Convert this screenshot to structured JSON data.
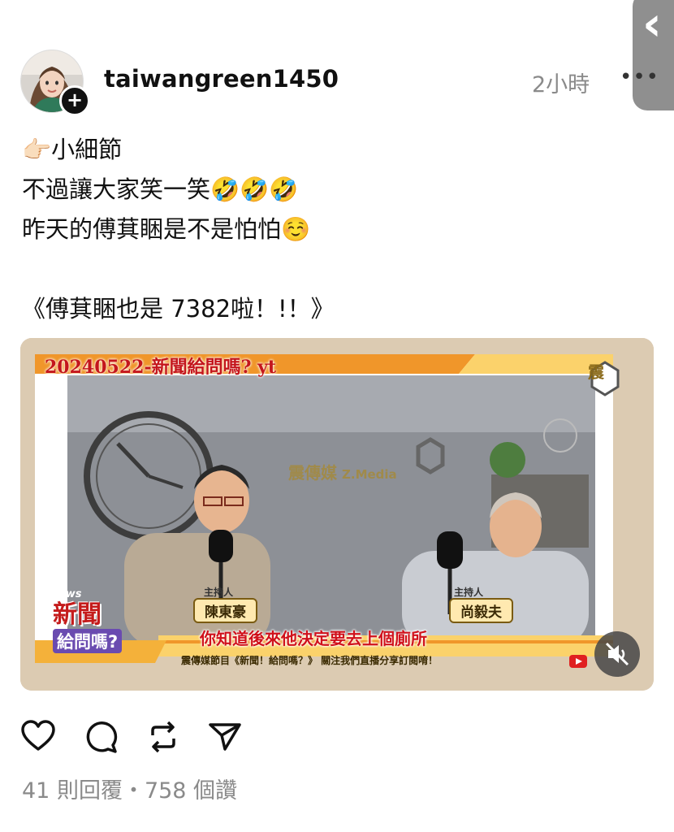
{
  "post": {
    "username": "taiwangreen1450",
    "timestamp": "2小時",
    "more_label": "•••",
    "follow_label": "+",
    "text_lines": [
      "👉🏻小細節",
      "不過讓大家笑一笑🤣🤣🤣",
      "昨天的傅萁睏是不是怕怕☺️",
      "",
      "《傅萁睏也是 7382啦！!！》"
    ]
  },
  "video": {
    "title": "20240522-新聞給問嗎? yt",
    "brand": "震傳媒",
    "brand_en": "Z.Media",
    "host_tag": "主持人",
    "host_left_name": "陳東豪",
    "host_right_name": "尚毅夫",
    "subtitle": "你知道後來他決定要去上個廁所",
    "ticker": "震傳媒節目《新聞！給問嗎？》 關注我們直播分享訂閱唷！",
    "show_news": "News",
    "show_line1": "新聞",
    "show_line2": "給問嗎?",
    "logo_char": "震"
  },
  "stats": {
    "text": "41 則回覆・758 個讚"
  },
  "icons": [
    "heart-icon",
    "comment-icon",
    "repost-icon",
    "share-icon",
    "mute-icon",
    "chevron-left-icon",
    "more-icon"
  ],
  "colors": {
    "accent_red": "#d0111b",
    "frame_orange": "#f0962a",
    "frame_purple": "#6a4bb0",
    "muted_text": "#8a8a8a"
  }
}
